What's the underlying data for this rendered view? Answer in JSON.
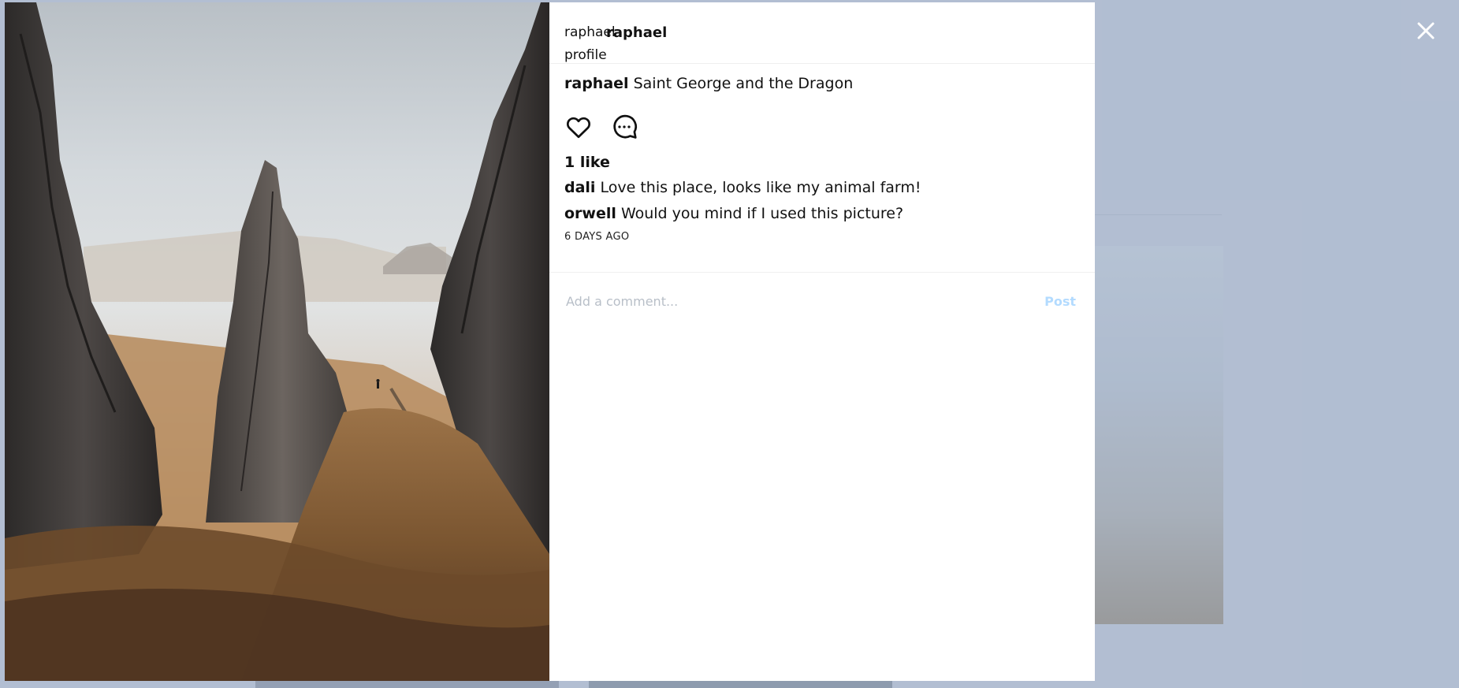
{
  "header": {
    "avatar_alt": "raphael profile",
    "username": "raphael"
  },
  "post": {
    "author": "raphael",
    "caption": "Saint George and the Dragon",
    "likes_text": "1 like",
    "timestamp": "6 DAYS AGO"
  },
  "comments": [
    {
      "user": "dali",
      "text": "Love this place, looks like my animal farm!"
    },
    {
      "user": "orwell",
      "text": "Would you mind if I used this picture?"
    }
  ],
  "comment_form": {
    "placeholder": "Add a comment...",
    "post_label": "Post"
  },
  "icons": {
    "close": "close-icon",
    "like": "heart-icon",
    "comment": "comment-icon"
  },
  "colors": {
    "post_button_disabled": "#b3dbff",
    "overlay": "#b5bfd0"
  }
}
